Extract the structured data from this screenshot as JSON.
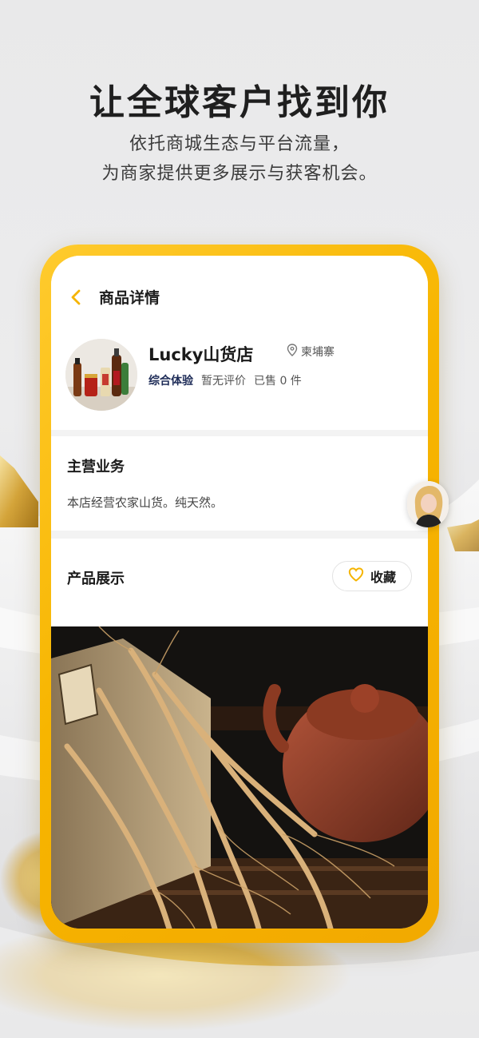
{
  "promo": {
    "title": "让全球客户找到你",
    "subtitle_line1": "依托商城生态与平台流量，",
    "subtitle_line2": "为商家提供更多展示与获客机会。"
  },
  "nav": {
    "title": "商品详情",
    "back_icon": "chevron-left-icon"
  },
  "shop": {
    "name": "Lucky山货店",
    "location": "柬埔寨",
    "experience_label": "综合体验",
    "rating_text": "暂无评价",
    "sold_text": "已售 0 件"
  },
  "business": {
    "title": "主营业务",
    "description": "本店经营农家山货。纯天然。"
  },
  "products": {
    "title": "产品展示",
    "favorite_label": "收藏"
  },
  "colors": {
    "frame_yellow": "#f7b500",
    "accent_yellow": "#f5b400",
    "experience_navy": "#1d2b57"
  }
}
